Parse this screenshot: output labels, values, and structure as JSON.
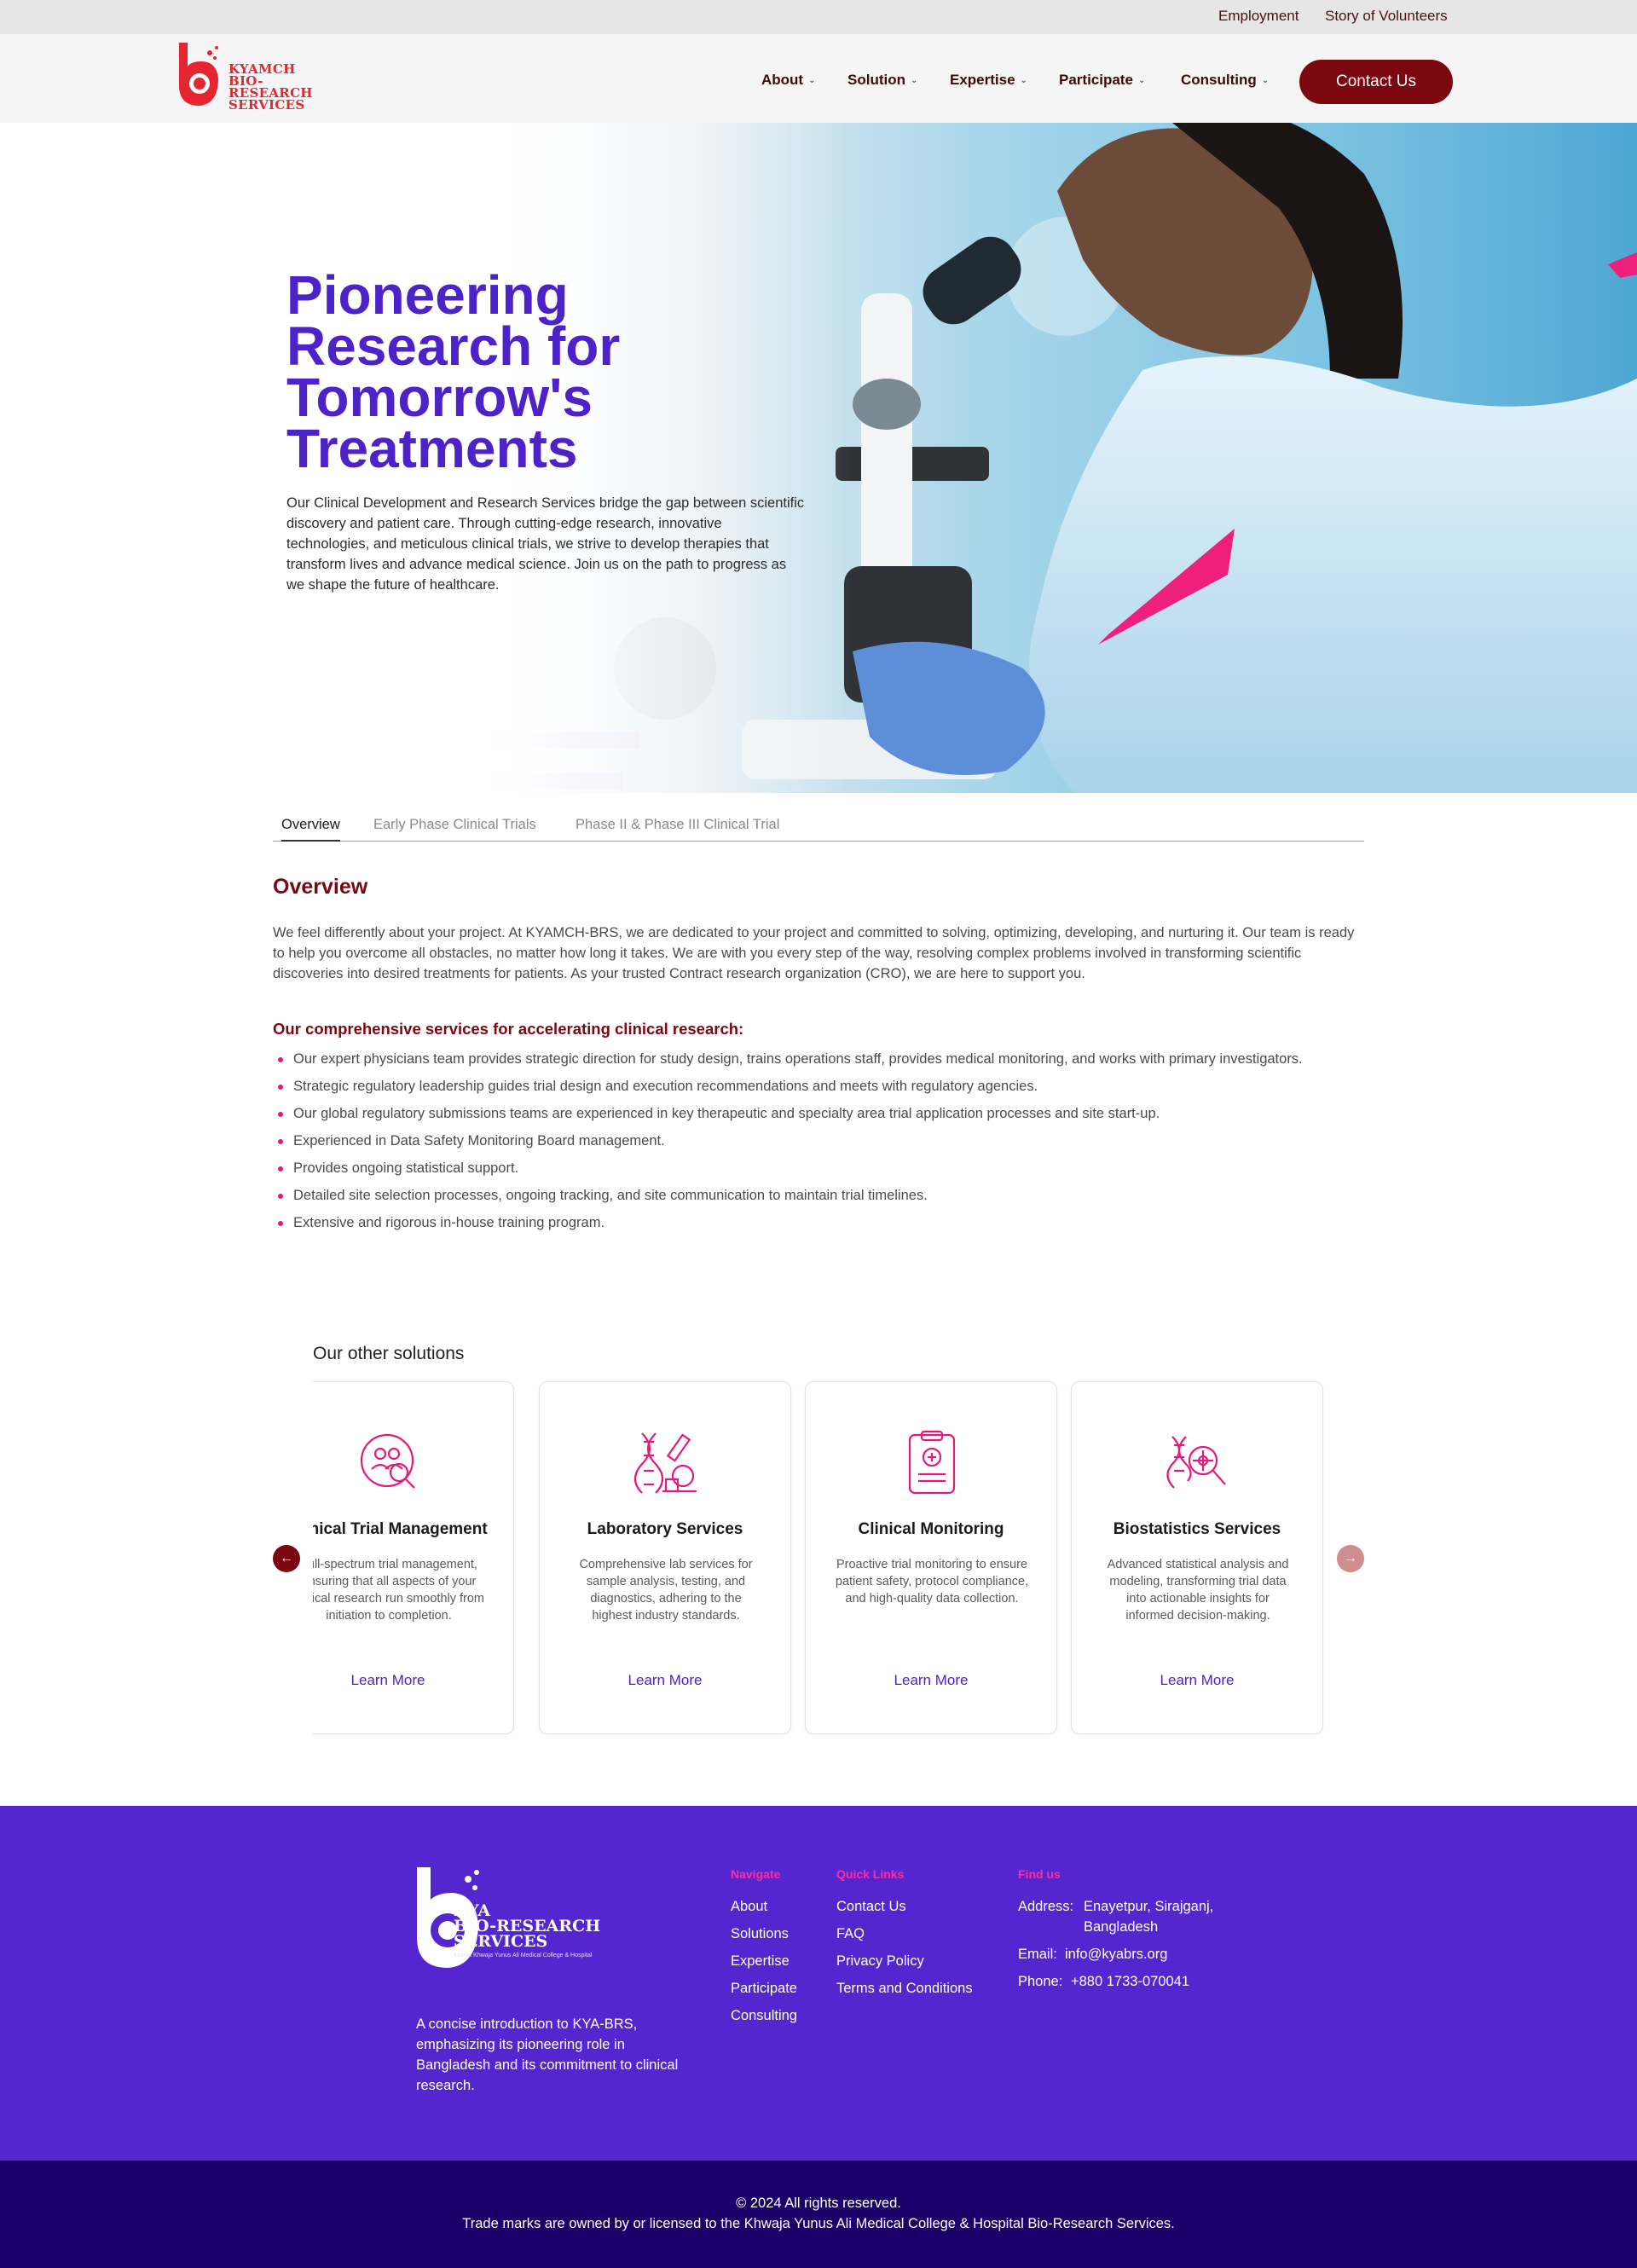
{
  "colors": {
    "brand_maroon": "#7b0810",
    "brand_red": "#e52630",
    "primary_purple": "#4d22c8",
    "footer_purple": "#5426cf",
    "footer_dark": "#1c0069",
    "accent_pink": "#e8187a"
  },
  "topbar": {
    "links": [
      "Employment",
      "Story of Volunteers"
    ]
  },
  "header": {
    "logo_text": [
      "KYAMCH",
      "BIO-RESEARCH",
      "SERVICES"
    ],
    "nav": [
      "About",
      "Solution",
      "Expertise",
      "Participate",
      "Consulting"
    ],
    "contact_label": "Contact Us"
  },
  "hero": {
    "title_lines": [
      "Pioneering",
      "Research for",
      "Tomorrow's",
      "Treatments"
    ],
    "description": "Our Clinical Development and Research Services bridge the gap between scientific discovery and patient care. Through cutting-edge research, innovative technologies, and meticulous clinical trials, we strive to develop therapies that transform lives and advance medical science. Join us on the path to progress as we shape the future of healthcare."
  },
  "tabs": [
    "Overview",
    "Early Phase Clinical Trials",
    "Phase II & Phase III Clinical Trial"
  ],
  "overview": {
    "title": "Overview",
    "text": "We feel differently about your project. At KYAMCH-BRS, we are dedicated to your project and committed to solving, optimizing, developing, and nurturing it. Our team is ready to help you overcome all obstacles, no matter how long it takes. We are with you every step of the way, resolving complex problems involved in transforming scientific discoveries into desired treatments for patients. As your trusted Contract research organization (CRO), we are here to support you.",
    "services_title": "Our comprehensive services for accelerating clinical research:",
    "services": [
      "Our expert physicians team provides strategic direction for study design, trains operations staff, provides medical monitoring, and works with primary investigators.",
      "Strategic regulatory leadership guides trial design and execution recommendations and meets with regulatory agencies.",
      "Our global regulatory submissions teams are experienced in key therapeutic and specialty area trial application processes and site start-up.",
      "Experienced in Data Safety Monitoring Board management.",
      "Provides ongoing statistical support.",
      "Detailed site selection processes, ongoing tracking, and site communication to maintain trial timelines.",
      "Extensive and rigorous in-house training program."
    ]
  },
  "other_solutions": {
    "title": "Our other solutions",
    "cards": [
      {
        "icon": "trial-management-icon",
        "title": "Clinical Trial Management",
        "text": "Full-spectrum trial management, ensuring that all aspects of your clinical research run smoothly from initiation to completion.",
        "link": "Learn More"
      },
      {
        "icon": "laboratory-icon",
        "title": "Laboratory Services",
        "text": "Comprehensive lab services for sample analysis, testing, and diagnostics, adhering to the highest industry standards.",
        "link": "Learn More"
      },
      {
        "icon": "clipboard-monitoring-icon",
        "title": "Clinical Monitoring",
        "text": "Proactive trial monitoring to ensure patient safety, protocol compliance, and high-quality data collection.",
        "link": "Learn More"
      },
      {
        "icon": "dna-analysis-icon",
        "title": "Biostatistics Services",
        "text": "Advanced statistical analysis and modeling, transforming trial data into actionable insights for informed decision-making.",
        "link": "Learn More"
      }
    ],
    "prev_icon": "arrow-left-icon",
    "next_icon": "arrow-right-icon"
  },
  "footer": {
    "logo_text": [
      "KYA",
      "BIO-RESEARCH",
      "SERVICES"
    ],
    "logo_sub": "Unit of Khwaja Yunus Ali Medical College & Hospital",
    "about": "A concise introduction to KYA-BRS, emphasizing its pioneering role in Bangladesh and its commitment to clinical research.",
    "navigate": {
      "title": "Navigate",
      "items": [
        "About",
        "Solutions",
        "Expertise",
        "Participate",
        "Consulting"
      ]
    },
    "quick_links": {
      "title": "Quick Links",
      "items": [
        "Contact Us",
        "FAQ",
        "Privacy Policy",
        "Terms and Conditions"
      ]
    },
    "find_us": {
      "title": "Find us",
      "address_label": "Address:",
      "address_line1": "Enayetpur, Sirajganj,",
      "address_line2": "Bangladesh",
      "email_label": "Email:",
      "email": "info@kyabrs.org",
      "phone_label": "Phone:",
      "phone": "+880 1733-070041"
    },
    "copyright": "© 2024 All rights reserved.",
    "trademark": "Trade marks are owned by or licensed to the Khwaja Yunus Ali Medical College & Hospital Bio-Research Services."
  }
}
